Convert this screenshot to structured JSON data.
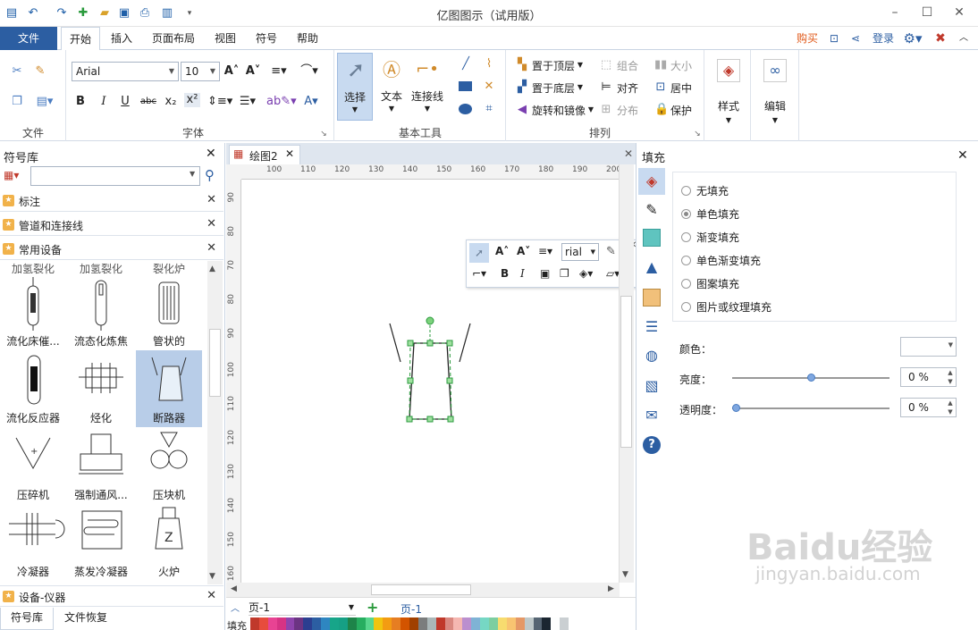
{
  "app": {
    "title": "亿图图示（试用版）"
  },
  "menu": {
    "file": "文件",
    "home": "开始",
    "insert": "插入",
    "layout": "页面布局",
    "view": "视图",
    "symbol": "符号",
    "help": "帮助",
    "buy": "购买",
    "login": "登录"
  },
  "ribbon": {
    "font_name": "Arial",
    "font_size": "10",
    "groups": {
      "file": "文件",
      "font": "字体",
      "basic_tools": "基本工具",
      "arrange": "排列"
    },
    "tools": {
      "select": "选择",
      "text": "文本",
      "connector": "连接线"
    },
    "arrange": {
      "to_top": "置于顶层",
      "to_bottom": "置于底层",
      "rotate": "旋转和镜像",
      "group": "组合",
      "align": "对齐",
      "distribute": "分布",
      "size": "大小",
      "center": "居中",
      "protect": "保护"
    },
    "style": "样式",
    "edit": "编辑"
  },
  "library": {
    "title": "符号库",
    "search_placeholder": "",
    "categories": [
      "标注",
      "管道和连接线",
      "常用设备"
    ],
    "clipped_row": [
      "加氢裂化",
      "加氢裂化",
      "裂化炉"
    ],
    "symbols": [
      "流化床催...",
      "流态化炼焦",
      "管状的",
      "流化反应器",
      "烃化",
      "断路器",
      "压碎机",
      "强制通风...",
      "压块机",
      "冷凝器",
      "蒸发冷凝器",
      "火炉"
    ],
    "bottom_category": "设备-仪器",
    "tabs": [
      "符号库",
      "文件恢复"
    ]
  },
  "canvas": {
    "doc_tab": "绘图2",
    "ruler_h": [
      "100",
      "110",
      "120",
      "130",
      "140",
      "150",
      "160",
      "170",
      "180",
      "190",
      "200"
    ],
    "ruler_v": [
      "90",
      "80",
      "70",
      "80",
      "90",
      "100",
      "110",
      "120",
      "130",
      "140",
      "150",
      "160"
    ],
    "floating_font": "rial",
    "page_select": "页-1",
    "page_tab": "页-1",
    "fill_label": "填充"
  },
  "fill": {
    "title": "填充",
    "options": [
      "无填充",
      "单色填充",
      "渐变填充",
      "单色渐变填充",
      "图案填充",
      "图片或纹理填充"
    ],
    "selected": "单色填充",
    "color_label": "颜色：",
    "brightness_label": "亮度：",
    "brightness_value": "0 %",
    "brightness_level": 0.5,
    "transparency_label": "透明度：",
    "transparency_value": "0 %",
    "transparency_level": 0
  },
  "watermark": {
    "text": "Baidu经验",
    "url": "jingyan.baidu.com"
  },
  "colors": {
    "accent": "#2c5ea2",
    "buy": "#e05a1b",
    "selection": "#b8cde8"
  }
}
